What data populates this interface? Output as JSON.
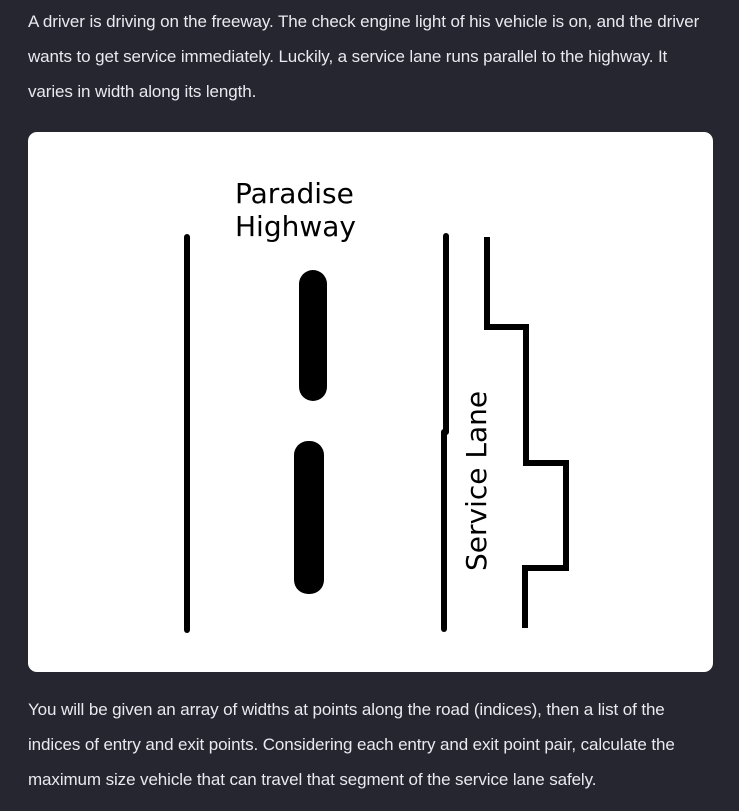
{
  "intro_text": "A driver is driving on the freeway. The check engine light of his vehicle is on, and the driver wants to get service immediately. Luckily, a service lane runs parallel to the highway. It varies in width along its length.",
  "diagram": {
    "highway_label_line1": "Paradise",
    "highway_label_line2": "Highway",
    "service_lane_label": "Service Lane"
  },
  "outro_text": "You will be given an array of widths at points along the road (indices), then a list of the indices of entry and exit points. Considering each entry and exit point pair, calculate the maximum size vehicle that can travel that segment of the service lane safely."
}
